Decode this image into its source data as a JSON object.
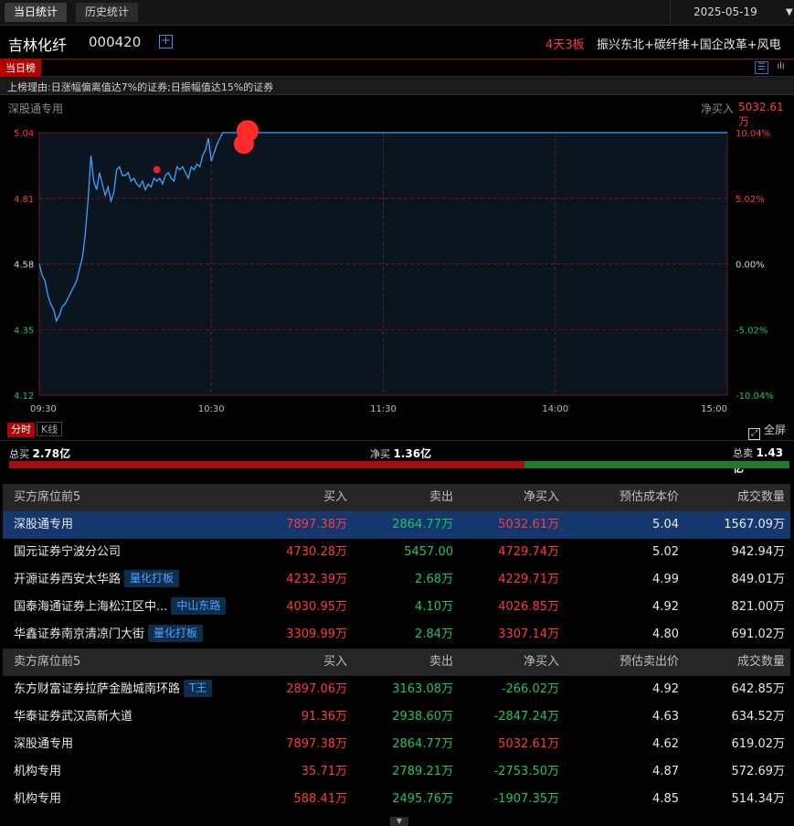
{
  "tabs": [
    {
      "label": "当日统计"
    },
    {
      "label": "历史统计"
    }
  ],
  "date": "2025-05-19",
  "stock": {
    "name": "吉林化纤",
    "code": "000420",
    "boards": "4天3板",
    "concepts": "振兴东北+碳纤维+国企改革+风电"
  },
  "rank_tag": "当日榜",
  "reason": "上榜理由:日涨幅偏离值达7%的证券;日振幅值达15%的证券",
  "chart_header": {
    "seller": "深股通专用",
    "netbuy_label": "净买入",
    "netbuy_value": "5032.61万"
  },
  "chart_tabs": [
    {
      "label": "分时"
    },
    {
      "label": "K线"
    }
  ],
  "fullscreen_label": "全屏",
  "totals": {
    "buy_label": "总买",
    "buy_value": "2.78亿",
    "net_label": "净买",
    "net_value": "1.36亿",
    "sell_label": "总卖",
    "sell_value": "1.43亿",
    "buy_fraction": 0.66
  },
  "colors": {
    "up": "#ff3b3b",
    "down": "#22c55e",
    "line": "#3ba3ff",
    "grid": "#6b1a1a",
    "selected_row": "#14376e"
  },
  "chart_data": {
    "type": "line",
    "y_ticks": [
      "5.04",
      "4.81",
      "4.58",
      "4.35",
      "4.12"
    ],
    "pct_ticks": [
      "10.04%",
      "5.02%",
      "0.00%",
      "-5.02%",
      "-10.04%"
    ],
    "x_ticks": [
      "09:30",
      "10:30",
      "11:30",
      "14:00",
      "15:00"
    ],
    "ylim": [
      4.12,
      5.04
    ],
    "prev_close": 4.58,
    "series": [
      {
        "x": [
          0,
          1,
          2,
          3,
          4,
          5,
          6,
          7,
          8,
          9,
          10,
          11,
          12,
          13,
          14,
          15,
          16,
          17,
          18,
          19,
          20,
          21,
          22,
          23,
          24,
          25,
          26,
          27,
          28,
          29,
          30,
          31,
          32,
          33,
          34,
          35,
          36,
          37,
          38,
          39,
          40,
          41,
          42,
          43,
          44,
          45,
          46,
          47,
          48,
          49,
          50,
          51,
          52,
          53,
          54,
          55,
          56,
          57,
          58,
          59,
          60,
          62,
          64,
          66,
          68,
          70,
          72,
          74,
          240
        ],
        "y": [
          4.58,
          4.54,
          4.52,
          4.47,
          4.44,
          4.42,
          4.38,
          4.4,
          4.43,
          4.44,
          4.46,
          4.48,
          4.5,
          4.52,
          4.56,
          4.6,
          4.68,
          4.8,
          4.96,
          4.87,
          4.84,
          4.9,
          4.86,
          4.82,
          4.85,
          4.8,
          4.83,
          4.91,
          4.92,
          4.89,
          4.89,
          4.9,
          4.87,
          4.88,
          4.86,
          4.85,
          4.87,
          4.84,
          4.86,
          4.85,
          4.88,
          4.87,
          4.88,
          4.86,
          4.89,
          4.9,
          4.88,
          4.87,
          4.92,
          4.91,
          4.92,
          4.9,
          4.88,
          4.92,
          4.91,
          4.93,
          4.92,
          4.96,
          4.98,
          5.02,
          4.94,
          5.0,
          5.04,
          5.04,
          5.04,
          5.04,
          5.04,
          5.04,
          5.04
        ]
      }
    ],
    "markers": [
      {
        "x": 41,
        "y": 4.91,
        "size": "small"
      },
      {
        "x": 72,
        "y": 5.02,
        "size": "large"
      }
    ],
    "grid": true
  },
  "buy_table": {
    "headers": [
      "买方席位前5",
      "买入",
      "卖出",
      "净买入",
      "预估成本价",
      "成交数量"
    ],
    "rows": [
      {
        "name": "深股通专用",
        "tag": "",
        "buy": "7897.38万",
        "sell": "2864.77万",
        "net": "5032.61万",
        "price": "5.04",
        "vol": "1567.09万"
      },
      {
        "name": "国元证券宁波分公司",
        "tag": "",
        "buy": "4730.28万",
        "sell": "5457.00",
        "net": "4729.74万",
        "price": "5.02",
        "vol": "942.94万"
      },
      {
        "name": "开源证券西安太华路",
        "tag": "量化打板",
        "buy": "4232.39万",
        "sell": "2.68万",
        "net": "4229.71万",
        "price": "4.99",
        "vol": "849.01万"
      },
      {
        "name": "国泰海通证券上海松江区中...",
        "tag": "中山东路",
        "buy": "4030.95万",
        "sell": "4.10万",
        "net": "4026.85万",
        "price": "4.92",
        "vol": "821.00万"
      },
      {
        "name": "华鑫证券南京清凉门大街",
        "tag": "量化打板",
        "buy": "3309.99万",
        "sell": "2.84万",
        "net": "3307.14万",
        "price": "4.80",
        "vol": "691.02万"
      }
    ]
  },
  "sell_table": {
    "headers": [
      "卖方席位前5",
      "买入",
      "卖出",
      "净买入",
      "预估卖出价",
      "成交数量"
    ],
    "rows": [
      {
        "name": "东方财富证券拉萨金融城南环路",
        "tag": "T王",
        "buy": "2897.06万",
        "sell": "3163.08万",
        "net": "-266.02万",
        "price": "4.92",
        "vol": "642.85万"
      },
      {
        "name": "华泰证券武汉高新大道",
        "tag": "",
        "buy": "91.36万",
        "sell": "2938.60万",
        "net": "-2847.24万",
        "price": "4.63",
        "vol": "634.52万"
      },
      {
        "name": "深股通专用",
        "tag": "",
        "buy": "7897.38万",
        "sell": "2864.77万",
        "net": "5032.61万",
        "price": "4.62",
        "vol": "619.02万"
      },
      {
        "name": "机构专用",
        "tag": "",
        "buy": "35.71万",
        "sell": "2789.21万",
        "net": "-2753.50万",
        "price": "4.87",
        "vol": "572.69万"
      },
      {
        "name": "机构专用",
        "tag": "",
        "buy": "588.41万",
        "sell": "2495.76万",
        "net": "-1907.35万",
        "price": "4.85",
        "vol": "514.34万"
      }
    ]
  }
}
